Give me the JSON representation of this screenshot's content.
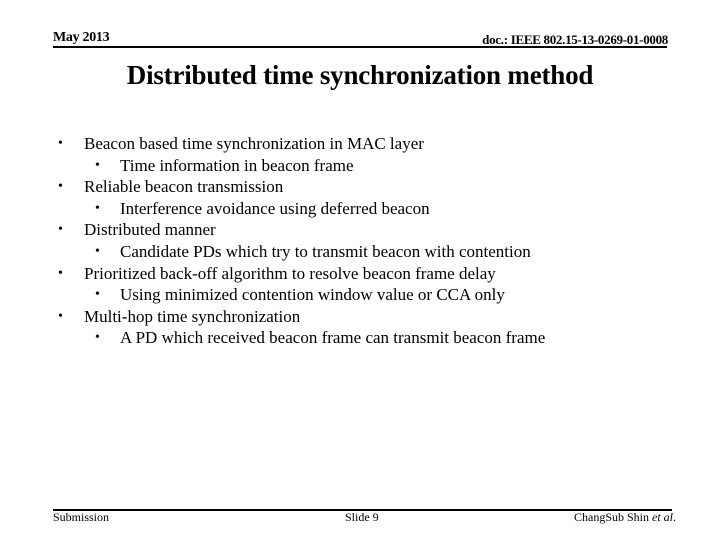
{
  "header": {
    "date": "May 2013",
    "doc_id": "doc.: IEEE 802.15-13-0269-01-0008"
  },
  "title": "Distributed time synchronization method",
  "bullets": [
    {
      "level": 1,
      "text": "Beacon based time synchronization in MAC layer"
    },
    {
      "level": 2,
      "text": "Time information in beacon frame"
    },
    {
      "level": 1,
      "text": "Reliable beacon transmission"
    },
    {
      "level": 2,
      "text": "Interference avoidance using deferred beacon"
    },
    {
      "level": 1,
      "text": "Distributed manner"
    },
    {
      "level": 2,
      "text": "Candidate PDs which try to transmit beacon with contention"
    },
    {
      "level": 1,
      "text": "Prioritized back-off algorithm to resolve beacon frame delay"
    },
    {
      "level": 2,
      "text": "Using minimized contention window value or CCA only"
    },
    {
      "level": 1,
      "text": "Multi-hop time synchronization"
    },
    {
      "level": 2,
      "text": "A PD which received beacon frame can transmit beacon frame"
    }
  ],
  "bullet_glyph": "•",
  "footer": {
    "left": "Submission",
    "center": "Slide 9",
    "author": "ChangSub Shin",
    "author_suffix": "et al",
    "author_end": "."
  }
}
